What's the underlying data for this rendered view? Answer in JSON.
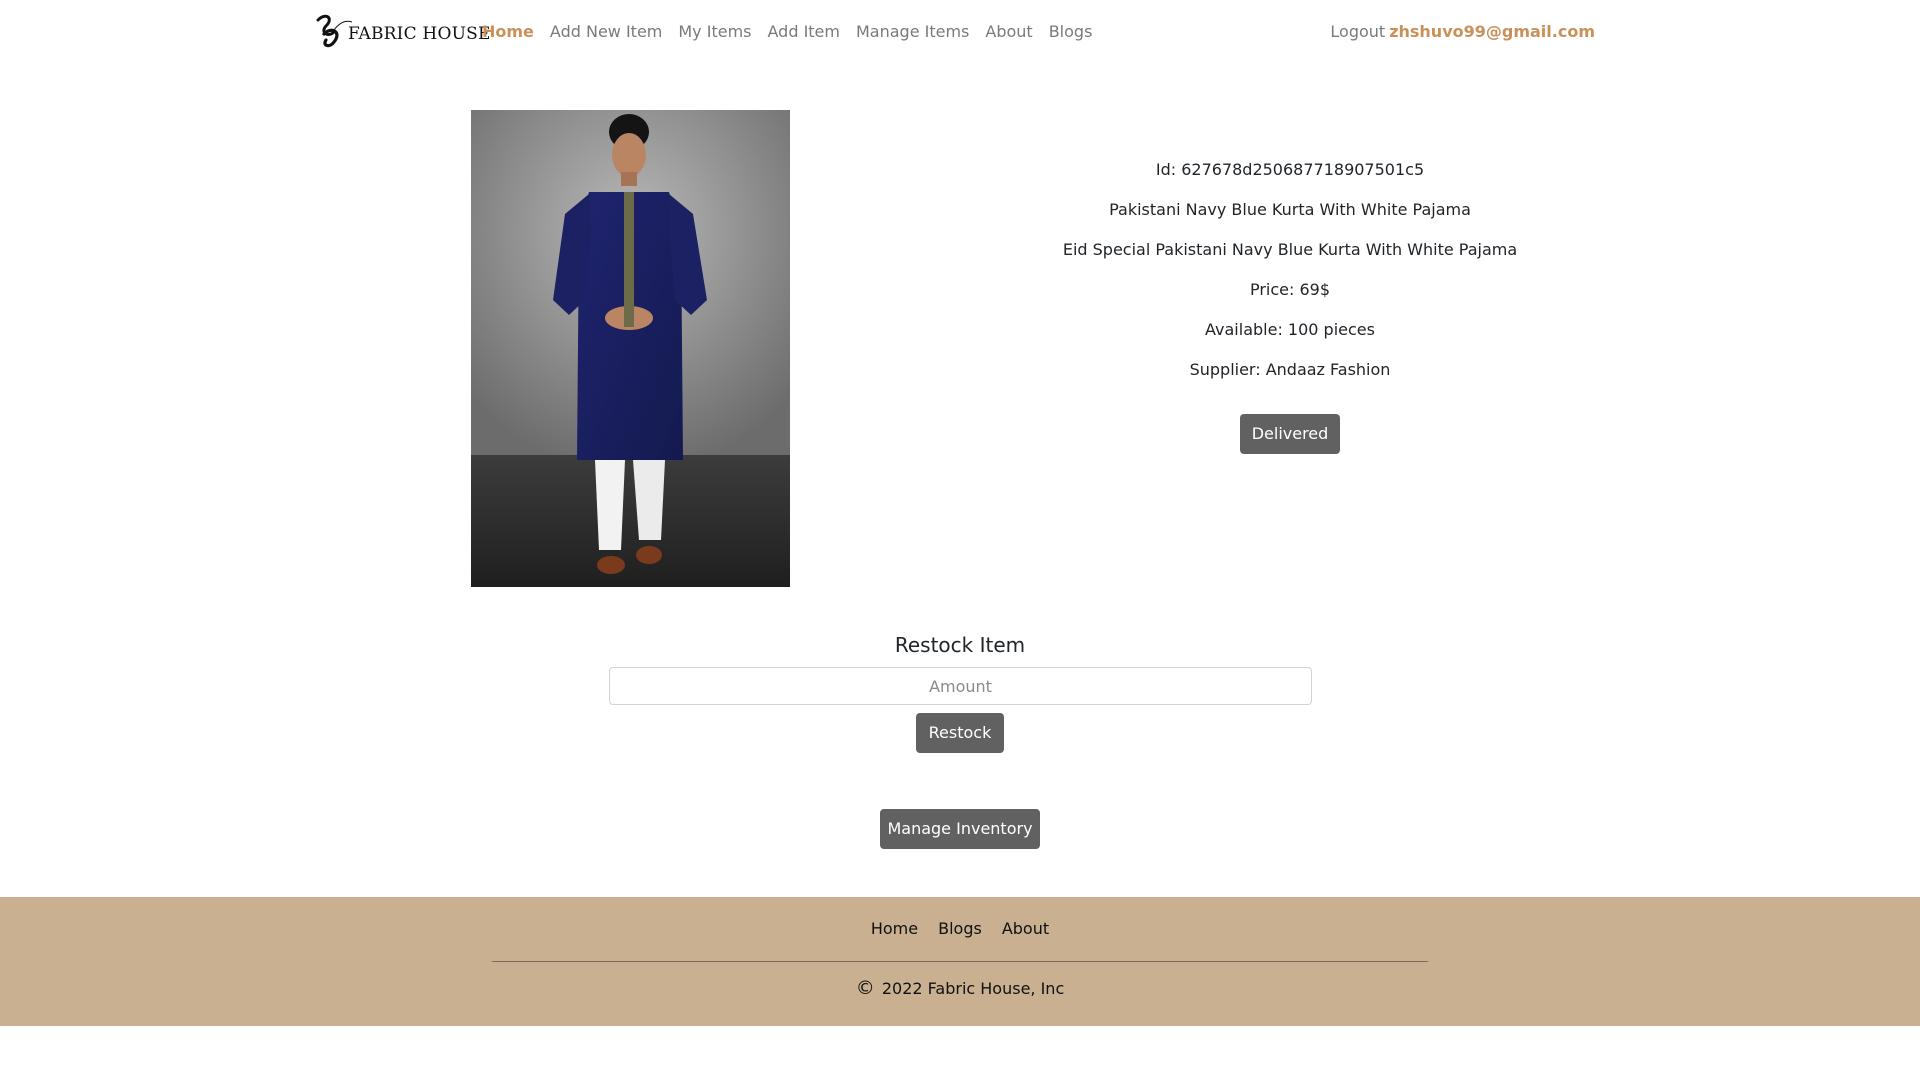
{
  "navbar": {
    "brand_text": "FABRIC HOUSE",
    "links": [
      {
        "label": "Home",
        "active": true
      },
      {
        "label": "Add New Item",
        "active": false
      },
      {
        "label": "My Items",
        "active": false
      },
      {
        "label": "Add Item",
        "active": false
      },
      {
        "label": "Manage Items",
        "active": false
      },
      {
        "label": "About",
        "active": false
      },
      {
        "label": "Blogs",
        "active": false
      }
    ],
    "logout_label": "Logout",
    "user_email": "zhshuvo99@gmail.com"
  },
  "product": {
    "image_icon": "product-photo",
    "id_text": "Id: 627678d250687718907501c5",
    "name": "Pakistani Navy Blue Kurta With White Pajama",
    "description": "Eid Special Pakistani Navy Blue Kurta With White Pajama",
    "price_text": "Price: 69$",
    "available_text": "Available: 100 pieces",
    "supplier_text": "Supplier: Andaaz Fashion",
    "delivered_label": "Delivered"
  },
  "restock": {
    "title": "Restock Item",
    "amount_placeholder": "Amount",
    "amount_value": "",
    "button_label": "Restock"
  },
  "manage_inventory_label": "Manage Inventory",
  "footer": {
    "links": [
      "Home",
      "Blogs",
      "About"
    ],
    "copyright_symbol": "©",
    "copyright_text": "2022 Fabric House, Inc"
  },
  "colors": {
    "accent": "#c8915a",
    "button_bg": "#616161",
    "footer_bg": "#c9b091"
  }
}
